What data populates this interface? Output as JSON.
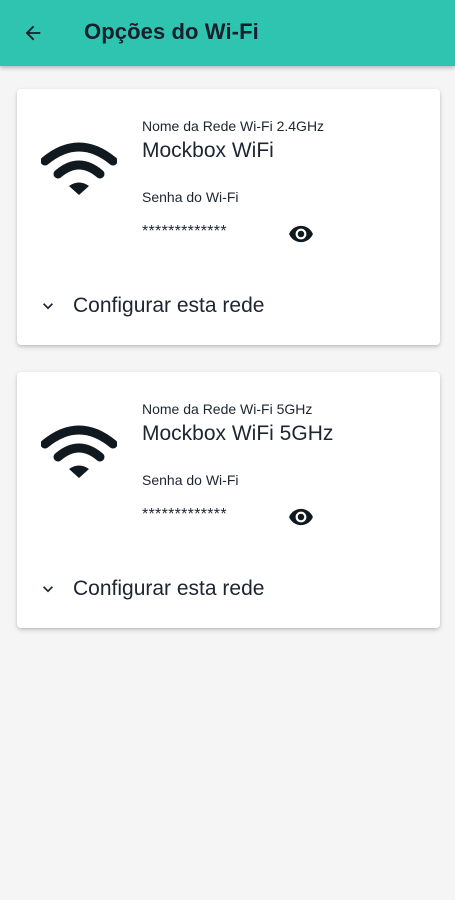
{
  "header": {
    "title": "Opções do Wi-Fi",
    "back_icon": "arrow-left-icon",
    "background": "#2ec4b0"
  },
  "networks": [
    {
      "name_label": "Nome da Rede Wi-Fi 2.4GHz",
      "ssid": "Mockbox WiFi",
      "password_label": "Senha do Wi-Fi",
      "password_masked": "*************",
      "reveal_icon": "eye-icon",
      "configure_label": "Configurar esta rede",
      "configure_icon": "chevron-down-icon",
      "icon": "wifi-icon"
    },
    {
      "name_label": "Nome da Rede Wi-Fi 5GHz",
      "ssid": "Mockbox WiFi 5GHz",
      "password_label": "Senha do Wi-Fi",
      "password_masked": "*************",
      "reveal_icon": "eye-icon",
      "configure_label": "Configurar esta rede",
      "configure_icon": "chevron-down-icon",
      "icon": "wifi-icon"
    }
  ]
}
